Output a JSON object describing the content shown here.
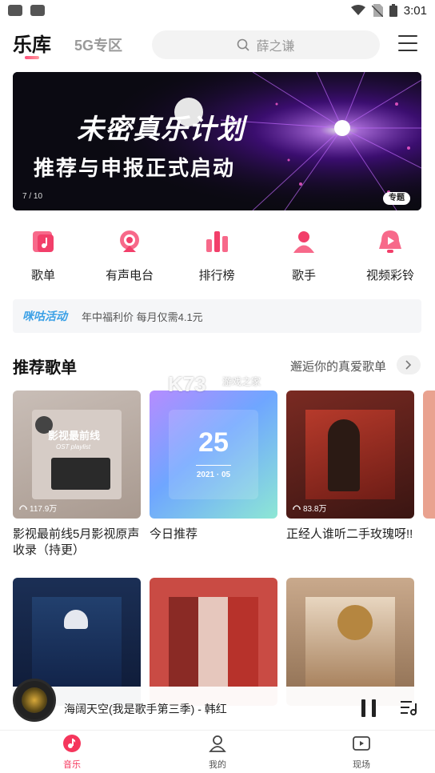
{
  "status_bar": {
    "time": "3:01"
  },
  "header": {
    "tab_main": "乐库",
    "tab_5g": "5G专区",
    "search_placeholder": "薛之谦"
  },
  "banner": {
    "title_line1": "未密真乐计划",
    "title_line2": "推荐与申报正式启动",
    "page_indicator": "7 / 10",
    "tag": "专题"
  },
  "categories": [
    {
      "label": "歌单",
      "icon": "playlist-icon"
    },
    {
      "label": "有声电台",
      "icon": "radio-icon"
    },
    {
      "label": "排行榜",
      "icon": "ranking-icon"
    },
    {
      "label": "歌手",
      "icon": "singer-icon"
    },
    {
      "label": "视频彩铃",
      "icon": "video-ringtone-icon"
    }
  ],
  "promo": {
    "brand": "咪咕活动",
    "text": "年中福利价 每月仅需4.1元"
  },
  "section": {
    "title": "推荐歌单",
    "more": "邂逅你的真爱歌单"
  },
  "watermark": {
    "text": "K73",
    "sub": "游戏之家"
  },
  "playlists_row1": [
    {
      "title": "影视最前线5月影视原声收录（持更）",
      "plays": "117.9万",
      "cover_text": "影视最前线",
      "cover_sub": "OST playlist"
    },
    {
      "title": "今日推荐",
      "day": "25",
      "date": "2021 · 05"
    },
    {
      "title": "正经人谁听二手玫瑰呀!!",
      "plays": "83.8万"
    }
  ],
  "playlists_row2": [
    {
      "title": ""
    },
    {
      "title": ""
    },
    {
      "title": ""
    }
  ],
  "player": {
    "title": "海阔天空(我是歌手第三季) - 韩红"
  },
  "bottom_nav": [
    {
      "label": "音乐",
      "active": true
    },
    {
      "label": "我的",
      "active": false
    },
    {
      "label": "现场",
      "active": false
    }
  ],
  "colors": {
    "accent": "#f5365c",
    "promo_brand": "#3aa0e6"
  }
}
